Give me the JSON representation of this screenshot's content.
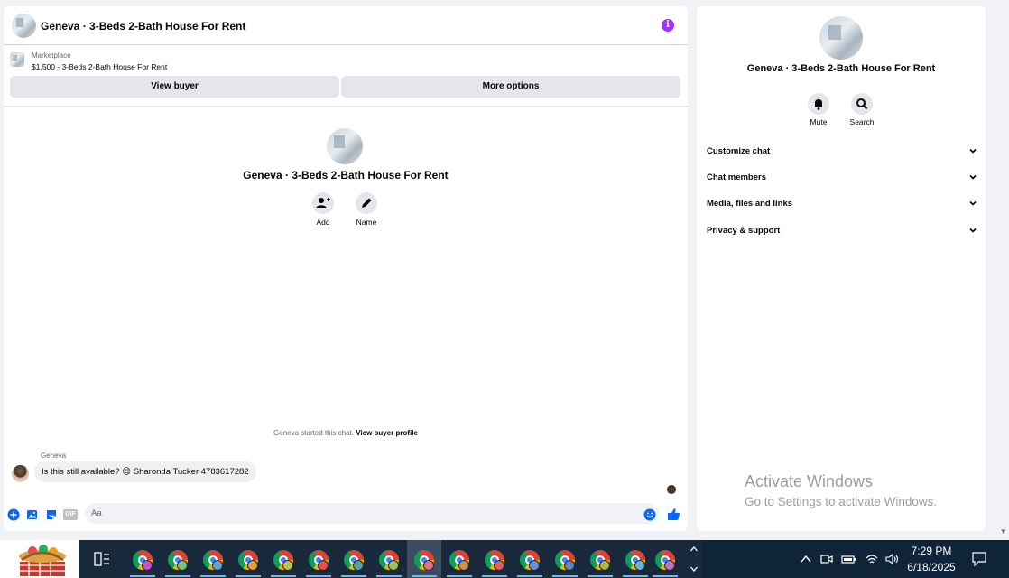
{
  "header": {
    "title": "Geneva · 3-Beds 2-Bath House For Rent",
    "info_icon": "i"
  },
  "marketplace": {
    "label": "Marketplace",
    "price_title": "$1,500 - 3-Beds 2-Bath House For Rent",
    "view_buyer": "View buyer",
    "more_options": "More options"
  },
  "conversation": {
    "title": "Geneva · 3-Beds 2-Bath House For Rent",
    "add_label": "Add",
    "name_label": "Name",
    "system_text": "Geneva started this chat.",
    "system_link": "View buyer profile",
    "sender": "Geneva",
    "message": "Is this still available? 😊 Sharonda Tucker 4783617282"
  },
  "composer": {
    "placeholder": "Aa",
    "gif_label": "GIF"
  },
  "side": {
    "title": "Geneva · 3-Beds 2-Bath House For Rent",
    "mute": "Mute",
    "search": "Search",
    "items": [
      "Customize chat",
      "Chat members",
      "Media, files and links",
      "Privacy & support"
    ]
  },
  "watermark": {
    "line1": "Activate Windows",
    "line2": "Go to Settings to activate Windows."
  },
  "taskbar": {
    "time": "7:29 PM",
    "date": "6/18/2025"
  },
  "colors": {
    "accent": "#0866ff",
    "info": "#a033ff"
  }
}
